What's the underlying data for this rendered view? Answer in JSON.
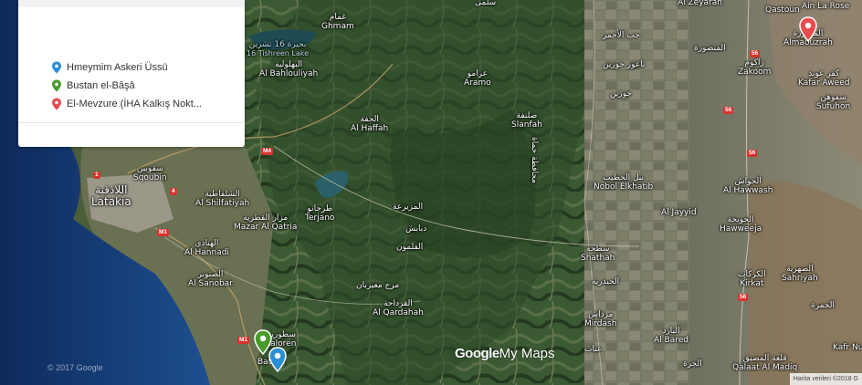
{
  "legend": {
    "items": [
      {
        "label": "Hmeymim Askeri Üssü",
        "color": "#2a8fd6"
      },
      {
        "label": "Bustan el-Bâşâ",
        "color": "#4a9a2c"
      },
      {
        "label": "El-Mevzure (İHA Kalkış Nokt...",
        "color": "#ea4b4b"
      }
    ]
  },
  "places": [
    {
      "en": "",
      "ar": "سلمى",
      "id": "salma-top"
    },
    {
      "en": "Al Zeyaran",
      "ar": "",
      "id": "al-zeyaran"
    },
    {
      "en": "Qastoun",
      "ar": "",
      "id": "qastoun"
    },
    {
      "en": "Ain La Rose",
      "ar": "",
      "id": "ain-la-rose"
    },
    {
      "en": "Ghmam",
      "ar": "غمام",
      "id": "ghmam"
    },
    {
      "en": "Al Bahlouliyah",
      "ar": "البهلولية",
      "id": "al-bahlouliyah"
    },
    {
      "en": "Aramo",
      "ar": "عرامو",
      "id": "aramo"
    },
    {
      "en": "",
      "ar": "جب الأحمر",
      "id": "jeb-al-ahmar"
    },
    {
      "en": "",
      "ar": "تاعور جورين",
      "id": "taour-jourin"
    },
    {
      "en": "",
      "ar": "جورين",
      "id": "jourin"
    },
    {
      "en": "",
      "ar": "المنصورة",
      "id": "al-mansoura"
    },
    {
      "en": "Zakoom",
      "ar": "زاكوم",
      "id": "zakoom"
    },
    {
      "en": "Almaouzrah",
      "ar": "المعوزرة",
      "id": "almaouzrah"
    },
    {
      "en": "Kafar Aweed",
      "ar": "كفر عويد",
      "id": "kafar-aweed"
    },
    {
      "en": "Sufuhon",
      "ar": "سفوهن",
      "id": "sufuhon"
    },
    {
      "en": "Al Haffah",
      "ar": "الحفة",
      "id": "al-haffah"
    },
    {
      "en": "Slanfah",
      "ar": "صلنفة",
      "id": "slanfah"
    },
    {
      "en": "Latakia",
      "ar": "اللاذقية",
      "id": "latakia"
    },
    {
      "en": "Sqoubin",
      "ar": "سقوبين",
      "id": "sqoubin"
    },
    {
      "en": "Al Shilfatiyah",
      "ar": "الشلفاطية",
      "id": "al-shilfatiyah"
    },
    {
      "en": "Terjano",
      "ar": "طرجانو",
      "id": "terjano"
    },
    {
      "en": "",
      "ar": "المزيرعة",
      "id": "al-mzeiraa"
    },
    {
      "en": "Nobol Elkhatib",
      "ar": "نبل الخطيب",
      "id": "nobol-elkhatib"
    },
    {
      "en": "Al Hawwash",
      "ar": "الحواش",
      "id": "al-hawwash"
    },
    {
      "en": "Mazar Al Qatria",
      "ar": "مزار القطرية",
      "id": "mazar-al-qatria"
    },
    {
      "en": "Al Hannadi",
      "ar": "الهنادي",
      "id": "al-hannadi"
    },
    {
      "en": "",
      "ar": "دبابش",
      "id": "dababish"
    },
    {
      "en": "",
      "ar": "الفلمون",
      "id": "al-qalamoun"
    },
    {
      "en": "Al Jayyid",
      "ar": "",
      "id": "al-jayyid"
    },
    {
      "en": "Hawweeja",
      "ar": "الحويجة",
      "id": "hawweeja"
    },
    {
      "en": "Shathah",
      "ar": "شطحة",
      "id": "shathah"
    },
    {
      "en": "Al Sanobar",
      "ar": "الصنوبر",
      "id": "al-sanobar"
    },
    {
      "en": "",
      "ar": "مرج معيربان",
      "id": "marj-mairban"
    },
    {
      "en": "Kirkat",
      "ar": "الكركات",
      "id": "kirkat"
    },
    {
      "en": "Sahriyah",
      "ar": "الصهرية",
      "id": "sahriyah"
    },
    {
      "en": "Al Qardahah",
      "ar": "القرداحة",
      "id": "al-qardahah"
    },
    {
      "en": "",
      "ar": "الحيدرية",
      "id": "al-haydariyah"
    },
    {
      "en": "Mirdash",
      "ar": "مرداش",
      "id": "mirdash"
    },
    {
      "en": "",
      "ar": "الجمرة",
      "id": "al-jamra"
    },
    {
      "en": "Aaloren",
      "ar": "سطورين",
      "id": "aaloren"
    },
    {
      "en": "Al Bared",
      "ar": "البارد",
      "id": "al-bared"
    },
    {
      "en": "Kafr Nu...",
      "ar": "",
      "id": "kafr-nu"
    },
    {
      "en": "Batran",
      "ar": "",
      "id": "batran"
    },
    {
      "en": "",
      "ar": "عناب",
      "id": "anab"
    },
    {
      "en": "",
      "ar": "الجرة",
      "id": "al-jarra"
    },
    {
      "en": "Qalaat Al Madiq",
      "ar": "قلعة المضيق",
      "id": "qalaat-al-madiq"
    },
    {
      "en": "",
      "ar": "محافظة حماة",
      "id": "hama-governorate"
    },
    {
      "en": "16 Tishreen Lake",
      "ar": "بحيرة 16 تشرين",
      "id": "tishreen-lake"
    }
  ],
  "road_shields": [
    {
      "label": "M4",
      "id": "m4-a",
      "color": "#d9322e"
    },
    {
      "label": "1",
      "id": "r1-a",
      "color": "#d9322e"
    },
    {
      "label": "4",
      "id": "r4-a",
      "color": "#d9322e"
    },
    {
      "label": "M1",
      "id": "m1-a",
      "color": "#d9322e"
    },
    {
      "label": "M1",
      "id": "m1-b",
      "color": "#d9322e"
    },
    {
      "label": "56",
      "id": "r56-a",
      "color": "#d9322e"
    },
    {
      "label": "56",
      "id": "r56-b",
      "color": "#d9322e"
    },
    {
      "label": "56",
      "id": "r56-c",
      "color": "#d9322e"
    },
    {
      "label": "56",
      "id": "r56-d",
      "color": "#d9322e"
    }
  ],
  "markers": [
    {
      "id": "marker-hmeymim",
      "color": "#2a8fd6"
    },
    {
      "id": "marker-bustan",
      "color": "#4a9a2c"
    },
    {
      "id": "marker-mevzure",
      "color": "#ea4b4b"
    }
  ],
  "watermark": {
    "google": "Google",
    "mymaps": "My Maps"
  },
  "copyright": "© 2017 Google",
  "attribution": "Harita verileri ©2018 G"
}
